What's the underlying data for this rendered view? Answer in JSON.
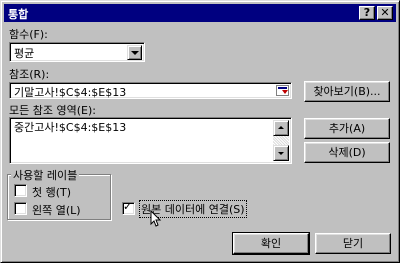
{
  "window": {
    "title": "통합",
    "help_label": "?",
    "close_label": "✕"
  },
  "function": {
    "label": "함수(F):",
    "value": "평균"
  },
  "reference": {
    "label": "참조(R):",
    "value": "기말고사!$C$4:$E$13",
    "browse_label": "찾아보기(B)..."
  },
  "all_references": {
    "label": "모든 참조 영역(E):",
    "items": [
      "중간고사!$C$4:$E$13"
    ],
    "add_label": "추가(A)",
    "delete_label": "삭제(D)"
  },
  "use_labels": {
    "title": "사용할 레이블",
    "top_row": {
      "label": "첫 행(T)",
      "checked": false
    },
    "left_column": {
      "label": "왼쪽 열(L)",
      "checked": false
    }
  },
  "link_source": {
    "label": "원본 데이터에 연결(S)",
    "checked": true,
    "check_mark": "✓"
  },
  "buttons": {
    "ok": "확인",
    "close": "닫기"
  },
  "icons": [
    "collapse-dialog-icon",
    "dropdown-arrow-icon",
    "scroll-up-icon",
    "scroll-down-icon",
    "mouse-pointer-icon"
  ]
}
